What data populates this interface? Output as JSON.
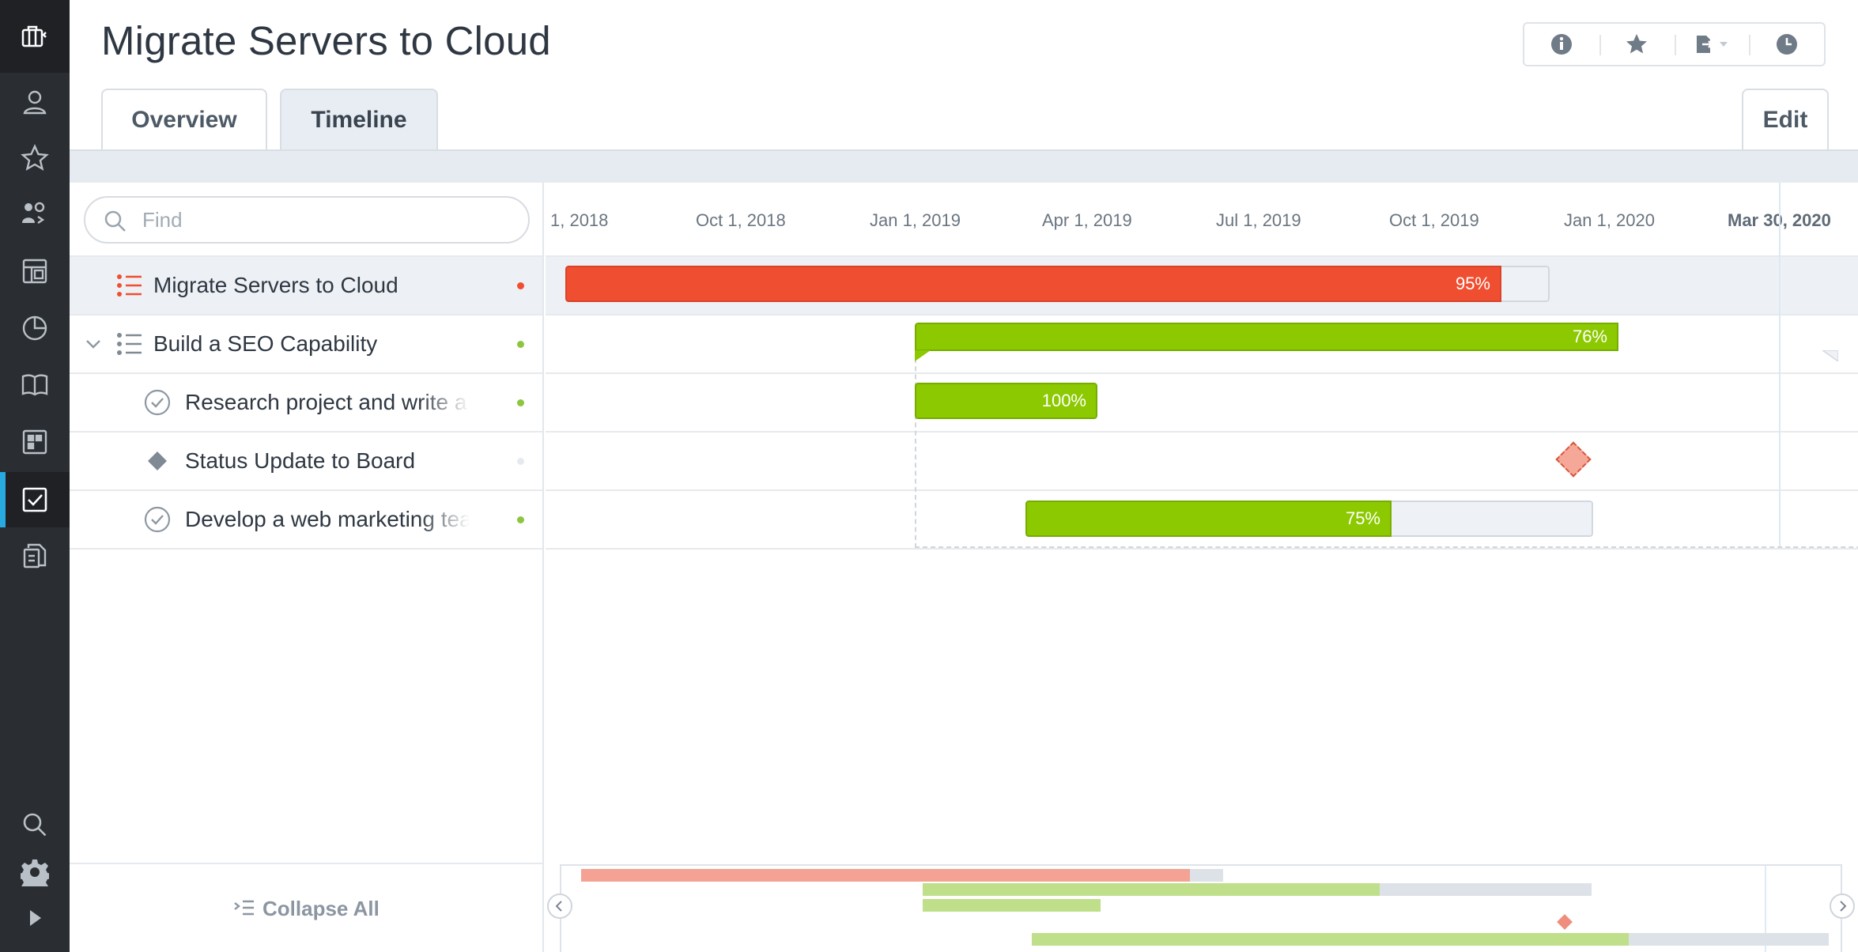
{
  "app": {
    "title": "Migrate Servers to Cloud"
  },
  "sidebar": {
    "items": [
      {
        "icon": "briefcase-icon",
        "label": ""
      },
      {
        "icon": "user-icon"
      },
      {
        "icon": "star-icon"
      },
      {
        "icon": "people-icon"
      },
      {
        "icon": "layout-icon"
      },
      {
        "icon": "pie-chart-icon"
      },
      {
        "icon": "book-icon"
      },
      {
        "icon": "dashboard-icon"
      },
      {
        "icon": "checkbox-icon",
        "active": true
      },
      {
        "icon": "documents-icon"
      },
      {
        "icon": "search-icon"
      },
      {
        "icon": "gear-icon"
      },
      {
        "icon": "expand-icon"
      }
    ]
  },
  "toolbar": {
    "buttons": [
      "info-icon",
      "star-icon",
      "export-icon",
      "clock-icon"
    ]
  },
  "tabs": [
    {
      "label": "Overview",
      "active": false
    },
    {
      "label": "Timeline",
      "active": true
    }
  ],
  "edit_label": "Edit",
  "search": {
    "placeholder": "Find",
    "value": ""
  },
  "tasks": [
    {
      "name": "Migrate Servers to Cloud",
      "type": "project",
      "status_color": "#f04e30",
      "selected": true
    },
    {
      "name": "Build a SEO Capability",
      "type": "project",
      "status_color": "#8cc63f",
      "expanded": true
    },
    {
      "name": "Research project and write a report",
      "type": "task",
      "status_color": "#8cc63f"
    },
    {
      "name": "Status Update to Board",
      "type": "milestone",
      "status_color": "#e6e9ed"
    },
    {
      "name": "Develop a web marketing team",
      "type": "task",
      "status_color": "#8cc63f"
    }
  ],
  "collapse_all_label": "Collapse All",
  "timeline": {
    "ticks": [
      "1, 2018",
      "Oct 1, 2018",
      "Jan 1, 2019",
      "Apr 1, 2019",
      "Jul 1, 2019",
      "Oct 1, 2019",
      "Jan 1, 2020"
    ],
    "today_label": "Mar 30, 2020",
    "bars": [
      {
        "task": "Migrate Servers to Cloud",
        "progress": 95,
        "progress_label": "95%",
        "color": "#f04e30"
      },
      {
        "task": "Build a SEO Capability",
        "progress": 76,
        "progress_label": "76%",
        "color": "#8cc900"
      },
      {
        "task": "Research project and write a report",
        "progress": 100,
        "progress_label": "100%",
        "color": "#8cc900"
      },
      {
        "task": "Develop a web marketing team",
        "progress": 75,
        "progress_label": "75%",
        "color": "#8cc900"
      }
    ],
    "milestone_color": "#f5a898"
  },
  "colors": {
    "rail": "#2a2d31",
    "accent": "#28a9e0",
    "red": "#f04e30",
    "green": "#8cc900"
  }
}
